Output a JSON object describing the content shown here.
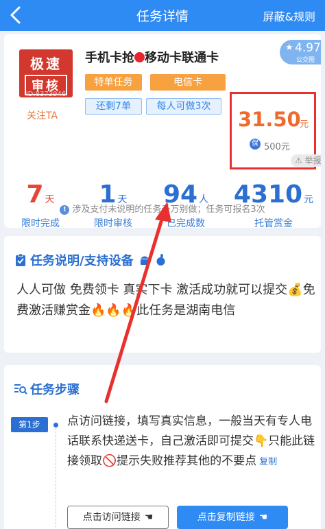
{
  "header": {
    "title": "任务详情",
    "right": "屏蔽&规则"
  },
  "task": {
    "logo_line1": "极速",
    "logo_line2": "审核",
    "logo_id": "ID:8373946",
    "follow": "关注TA",
    "title_left": "手机卡抢",
    "title_right": "移动卡联通卡",
    "tags": [
      "特单任务",
      "电信卡",
      "还剩7单",
      "每人可做3次"
    ],
    "rating": "4.97",
    "rating_sub": "公交图",
    "price": "31.50",
    "price_unit": "元",
    "deposit": "500元",
    "report": "举报"
  },
  "stats": [
    {
      "value": "7",
      "unit": "天",
      "label": "限时完成",
      "color": "red"
    },
    {
      "value": "1",
      "unit": "天",
      "label": "限时审核",
      "color": "blue"
    },
    {
      "value": "94",
      "unit": "人",
      "label": "已完成数",
      "color": "blue"
    },
    {
      "value": "4310",
      "unit": "元",
      "label": "托管赏金",
      "color": "blue"
    }
  ],
  "notice": "涉及支付未说明的任务千万别做；任务可报名3次",
  "description": {
    "title": "任务说明/支持设备",
    "text": "人人可做 免费领卡 真实下卡 激活成功就可以提交💰免费激活赚赏金🔥🔥🔥此任务是湖南电信"
  },
  "steps": {
    "title": "任务步骤",
    "step1_badge": "第1步",
    "step1_text": "点访问链接，填写真实信息，一般当天有专人电话联系快递送卡，自己激活即可提交👇只能此链接领取🚫提示失败推荐其他的不要点",
    "copy": "复制",
    "visit_button": "点击访问链接",
    "copy_button": "点击复制链接"
  },
  "colors": {
    "header": "#2f8bf4",
    "price": "#ee6b2f",
    "highlight": "#e8312e",
    "stat_red": "#e64735",
    "stat_blue": "#2a6fd1"
  }
}
